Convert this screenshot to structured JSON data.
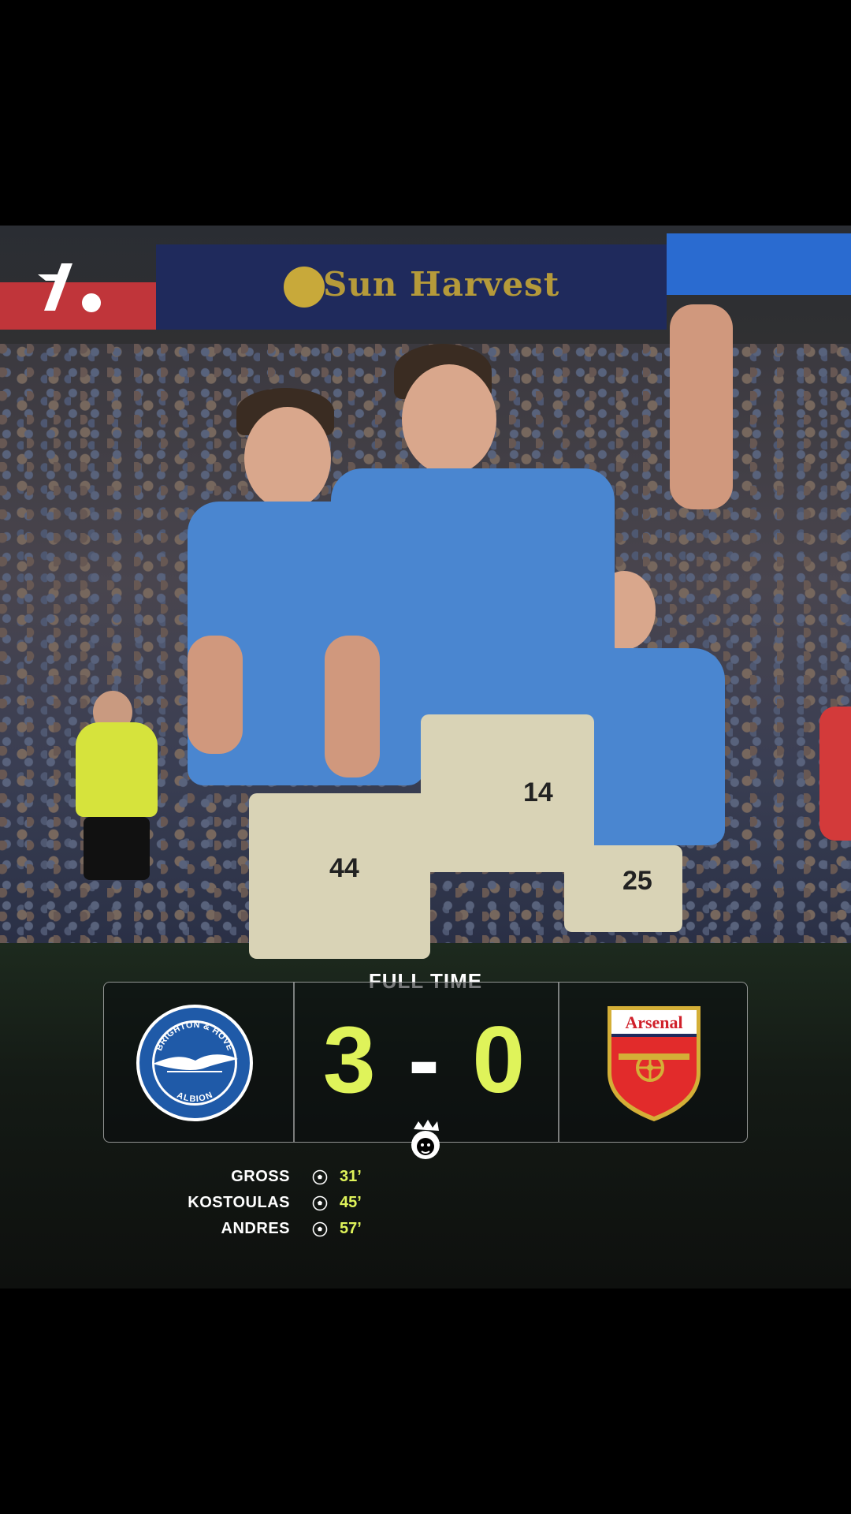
{
  "photo": {
    "board_text": "Sun Harvest",
    "players": [
      {
        "number": "44"
      },
      {
        "number": "14"
      },
      {
        "number": "25"
      }
    ]
  },
  "match": {
    "status": "FULL TIME",
    "home_score": "3",
    "separator": "-",
    "away_score": "0",
    "home_team": {
      "crest_top_text": "BRIGHTON & HOVE",
      "crest_bottom_text": "ALBION"
    },
    "away_team": {
      "crest_text": "Arsenal"
    }
  },
  "scorers": [
    {
      "name": "GROSS",
      "minute": "31’"
    },
    {
      "name": "KOSTOULAS",
      "minute": "45’"
    },
    {
      "name": "ANDRES",
      "minute": "57’"
    }
  ],
  "colors": {
    "score_accent": "#dff35a",
    "home_blue": "#1f5aa8",
    "away_red": "#e22b2b",
    "background": "#000000"
  }
}
